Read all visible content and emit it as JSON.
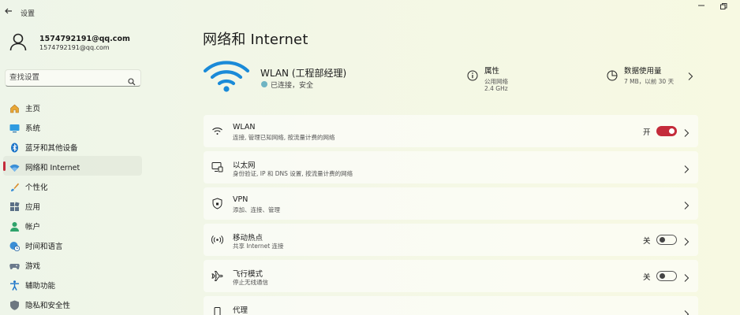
{
  "window": {
    "title": "设置"
  },
  "user": {
    "name": "1574792191@qq.com",
    "email": "1574792191@qq.com"
  },
  "search": {
    "placeholder": "查找设置"
  },
  "sidebar": {
    "items": [
      {
        "label": "主页",
        "icon": "home-icon",
        "active": false
      },
      {
        "label": "系统",
        "icon": "monitor-icon",
        "active": false
      },
      {
        "label": "蓝牙和其他设备",
        "icon": "bluetooth-icon",
        "active": false
      },
      {
        "label": "网络和 Internet",
        "icon": "wifi-icon",
        "active": true
      },
      {
        "label": "个性化",
        "icon": "brush-icon",
        "active": false
      },
      {
        "label": "应用",
        "icon": "apps-icon",
        "active": false
      },
      {
        "label": "帐户",
        "icon": "person-icon",
        "active": false
      },
      {
        "label": "时间和语言",
        "icon": "globe-clock-icon",
        "active": false
      },
      {
        "label": "游戏",
        "icon": "gamepad-icon",
        "active": false
      },
      {
        "label": "辅助功能",
        "icon": "accessibility-icon",
        "active": false
      },
      {
        "label": "隐私和安全性",
        "icon": "shield-icon",
        "active": false
      }
    ]
  },
  "main": {
    "title": "网络和 Internet",
    "hero": {
      "network_name": "WLAN (工程部经理)",
      "status": "已连接，安全"
    },
    "properties": {
      "title": "属性",
      "line1": "公用网络",
      "line2": "2.4 GHz"
    },
    "data_usage": {
      "title": "数据使用量",
      "line1": "7 MB，以前 30 天"
    },
    "rows": [
      {
        "title": "WLAN",
        "desc": "连接, 管理已知网络, 按流量计费的网络",
        "icon": "wifi-icon",
        "toggle_label": "开",
        "toggle_on": true
      },
      {
        "title": "以太网",
        "desc": "身份验证, IP 和 DNS 设置, 按流量计费的网络",
        "icon": "ethernet-icon",
        "toggle_label": "",
        "toggle_on": null
      },
      {
        "title": "VPN",
        "desc": "添加、连接、管理",
        "icon": "vpn-shield-icon",
        "toggle_label": "",
        "toggle_on": null
      },
      {
        "title": "移动热点",
        "desc": "共享 Internet 连接",
        "icon": "hotspot-icon",
        "toggle_label": "关",
        "toggle_on": false
      },
      {
        "title": "飞行模式",
        "desc": "停止无线通信",
        "icon": "airplane-icon",
        "toggle_label": "关",
        "toggle_on": false
      },
      {
        "title": "代理",
        "desc": "",
        "icon": "proxy-icon",
        "toggle_label": "",
        "toggle_on": null
      }
    ]
  },
  "colors": {
    "accent": "#c42b3a",
    "wifi_blue": "#1a8ad8"
  }
}
